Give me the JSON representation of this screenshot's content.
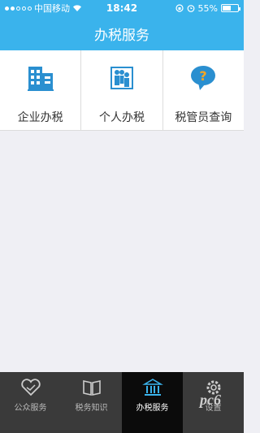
{
  "status_bar": {
    "carrier": "中国移动",
    "time": "18:42",
    "battery_percent": "55%",
    "signal_filled": 2,
    "signal_total": 5
  },
  "nav": {
    "title": "办税服务"
  },
  "services": [
    {
      "label": "企业办税",
      "icon": "building-icon"
    },
    {
      "label": "个人办税",
      "icon": "people-icon"
    },
    {
      "label": "税管员查询",
      "icon": "question-bubble-icon"
    }
  ],
  "tabs": [
    {
      "label": "公众服务",
      "icon": "handshake-icon",
      "active": false
    },
    {
      "label": "税务知识",
      "icon": "book-icon",
      "active": false
    },
    {
      "label": "办税服务",
      "icon": "bank-icon",
      "active": true
    },
    {
      "label": "设置",
      "icon": "gear-icon",
      "active": false
    }
  ],
  "colors": {
    "primary": "#3ab3ec",
    "tab_bg": "#3a3a3a",
    "tab_active_bg": "#0b0b0b",
    "accent_orange": "#f5a623"
  },
  "watermark": {
    "text": "pc6"
  }
}
